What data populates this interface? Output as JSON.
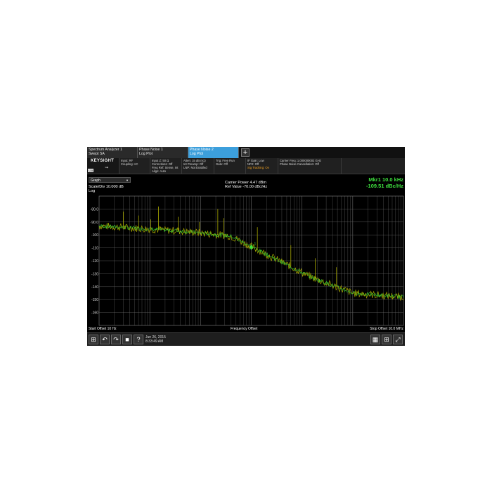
{
  "tabs": [
    {
      "line1": "Spectrum Analyzer 1",
      "line2": "Swept SA"
    },
    {
      "line1": "Phase Noise 1",
      "line2": "Log Plot"
    },
    {
      "line1": "Phase Noise 2",
      "line2": "Log Plot"
    }
  ],
  "add_tab_label": "+",
  "brand": "KEYSIGHT",
  "lxi_badge": "LXI",
  "settings": [
    [
      "Input: RF",
      "Coupling: AC"
    ],
    [
      "Input Z: 50 Ω",
      "Corrections: Off",
      "Freq Ref: Sense, Int",
      "Align: Auto"
    ],
    [
      "Atten: 15 dB (e1)",
      "Int Preamp: Off",
      "LNP: Not Enabled"
    ],
    [
      "Trig: Free Run",
      "Gate: Off"
    ],
    [
      "IF Gain: Low",
      "NFE: Off",
      "Sig Tracking: On"
    ],
    [
      "Carrier Freq: 1.000000002 GHz",
      "Phase Noise Cancellation: Off"
    ]
  ],
  "graph": {
    "view_select": "Graph",
    "scale_div": "Scale/Div 10.000 dB",
    "scale_type": "Log",
    "carrier_power": "Carrier Power 4.47 dBm",
    "ref_value": "Ref Value -70.00 dBc/Hz",
    "marker_freq": "Mkr1  10.0 kHz",
    "marker_value": "-109.51 dBc/Hz",
    "marker_label": "1",
    "y_labels": [
      "-80.0",
      "-90.0",
      "-100",
      "-110",
      "-120",
      "-130",
      "-140",
      "-150",
      "-160"
    ]
  },
  "axis": {
    "start": "Start Offset 10 Hz",
    "title": "Frequency Offset",
    "stop": "Stop Offset 10.0 MHz"
  },
  "taskbar": {
    "date": "Jun 26, 2015",
    "time": "8:33:49 AM"
  },
  "colors": {
    "trace_yellow": "#a8a800",
    "trace_green": "#33cc33",
    "grid": "#6a6a6a",
    "active_tab": "#3c9fdc",
    "marker": "#3ee03e"
  },
  "icons": [
    "windows-icon",
    "undo-icon",
    "redo-icon",
    "folder-icon",
    "help-icon",
    "layout-icon",
    "grid-icon",
    "fullscreen-icon"
  ]
}
